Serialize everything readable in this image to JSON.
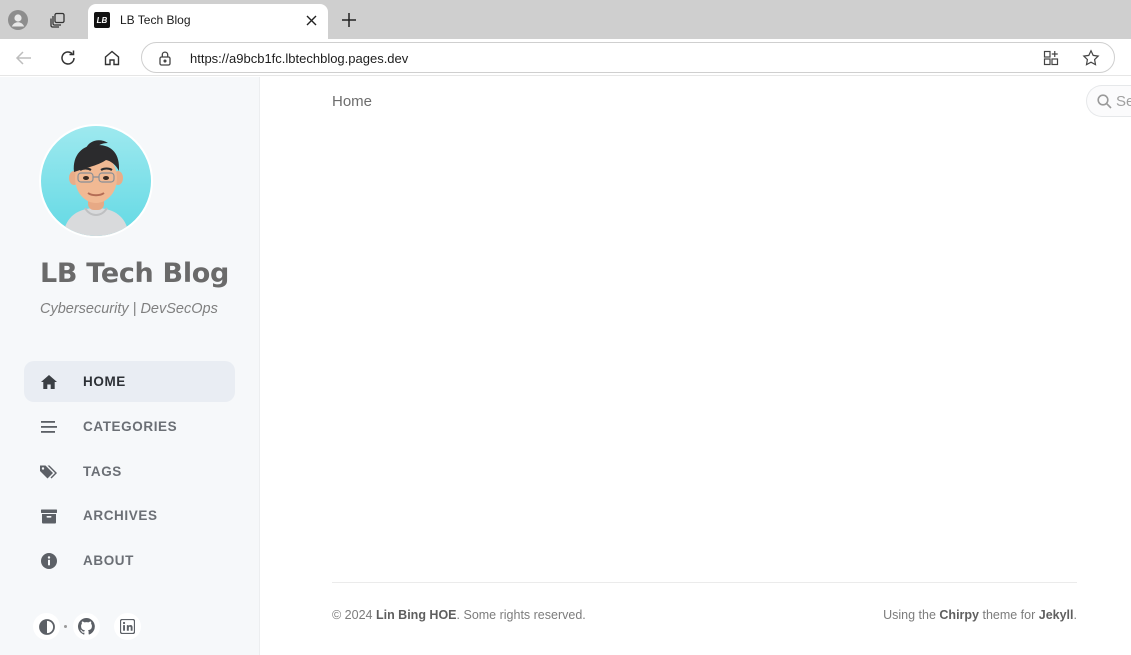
{
  "browser": {
    "tab_title": "LB Tech Blog",
    "favicon_text": "LB",
    "url": "https://a9bcb1fc.lbtechblog.pages.dev"
  },
  "sidebar": {
    "title": "LB Tech Blog",
    "subtitle": "Cybersecurity | DevSecOps",
    "items": [
      {
        "label": "HOME",
        "icon": "home-icon",
        "active": true
      },
      {
        "label": "CATEGORIES",
        "icon": "stream-icon",
        "active": false
      },
      {
        "label": "TAGS",
        "icon": "tags-icon",
        "active": false
      },
      {
        "label": "ARCHIVES",
        "icon": "archive-icon",
        "active": false
      },
      {
        "label": "ABOUT",
        "icon": "info-circle-icon",
        "active": false
      }
    ],
    "bottom_icons": [
      "theme-toggle-icon",
      "github-icon",
      "linkedin-icon"
    ]
  },
  "topbar": {
    "breadcrumb": "Home",
    "search_placeholder": "Search..."
  },
  "footer": {
    "copyright_prefix": "© 2024 ",
    "author": "Lin Bing HOE",
    "copyright_suffix": ". Some rights reserved.",
    "theme_prefix": "Using the ",
    "theme_name": "Chirpy",
    "theme_middle": " theme for ",
    "engine": "Jekyll",
    "theme_suffix": "."
  },
  "colors": {
    "sidebar_bg": "#f6f8fa",
    "active_item_bg": "#e9edf3",
    "avatar_bg": "#7fe1ea"
  }
}
